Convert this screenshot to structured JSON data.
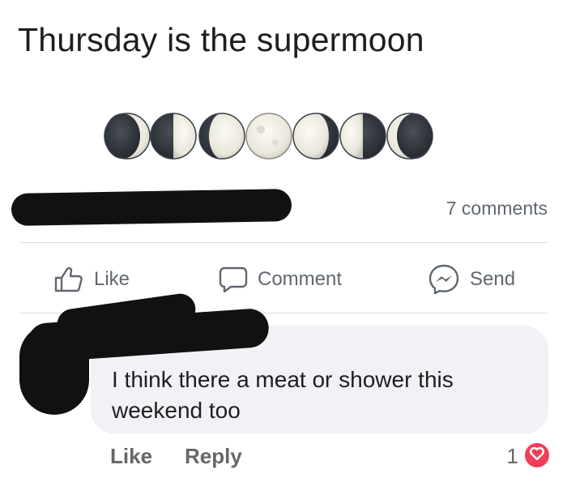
{
  "post": {
    "text": "Thursday is the supermoon",
    "moon_phases": [
      "waxing-crescent-moon-icon",
      "first-quarter-moon-icon",
      "waxing-gibbous-moon-icon",
      "full-moon-icon",
      "waning-gibbous-moon-icon",
      "last-quarter-moon-icon",
      "waning-crescent-moon-icon"
    ]
  },
  "stats": {
    "comments_label": "7 comments"
  },
  "actions": {
    "like_label": "Like",
    "comment_label": "Comment",
    "send_label": "Send"
  },
  "comment": {
    "text": "I think there a meat or shower this weekend too",
    "like_label": "Like",
    "reply_label": "Reply",
    "reaction_count": "1",
    "reaction_icon": "heart-icon",
    "reaction_color": "#f33e58"
  },
  "colors": {
    "text_primary": "#1c1e21",
    "text_secondary": "#606770",
    "bubble_bg": "#f0f2f5",
    "divider": "#dadde1",
    "redaction": "#111111"
  }
}
